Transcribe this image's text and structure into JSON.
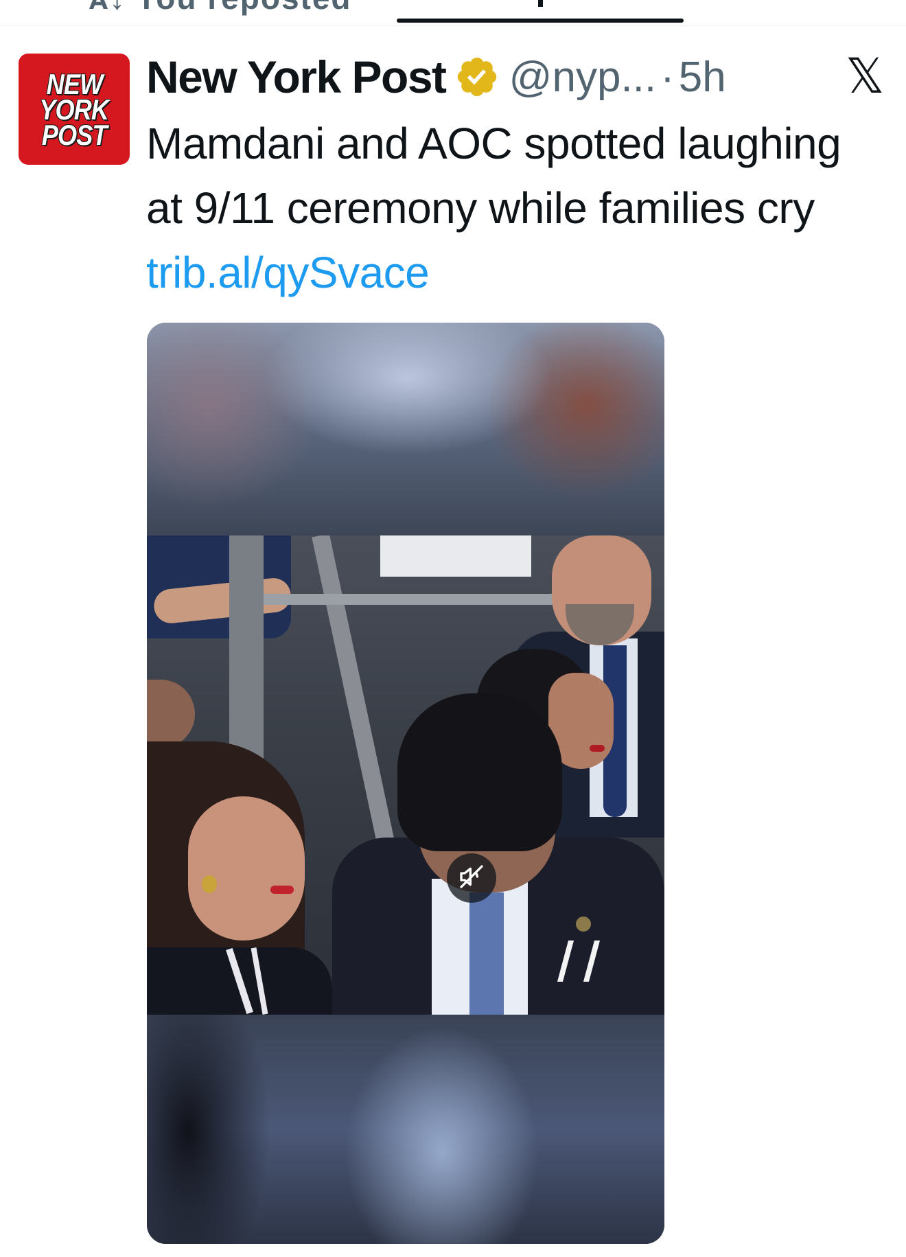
{
  "top": {
    "cut_text": "ᴀ↓ You reposted"
  },
  "tweet": {
    "avatar_lines": [
      "NEW",
      "YORK",
      "POST"
    ],
    "display_name": "New York Post",
    "verified_icon": "verified-gold-badge-icon",
    "handle": "@nyp...",
    "separator": "·",
    "time": "5h",
    "platform_logo": "𝕏",
    "text_before_link": "Mamdani and AOC spotted laughing at 9/11 ceremony while families cry ",
    "link_text": "trib.al/qySvace"
  },
  "media": {
    "type": "video",
    "mute_icon": "speaker-muted-icon"
  },
  "colors": {
    "brand_red": "#d5181f",
    "link_blue": "#1d9bf0",
    "verified_gold": "#e2b719",
    "text_primary": "#0f1419",
    "text_secondary": "#536471"
  }
}
